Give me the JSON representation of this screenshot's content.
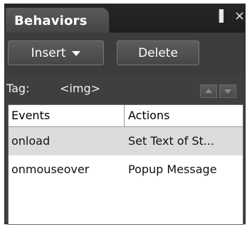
{
  "panel": {
    "title": "Behaviors",
    "pin_glyph": "▌",
    "close_glyph": "×"
  },
  "toolbar": {
    "insert_label": "Insert",
    "delete_label": "Delete"
  },
  "tag": {
    "label": "Tag:",
    "value": "<img>"
  },
  "table": {
    "columns": [
      "Events",
      "Actions"
    ],
    "rows": [
      {
        "event": "onload",
        "action": "Set Text of St...",
        "selected": true
      },
      {
        "event": "onmouseover",
        "action": "Popup Message",
        "selected": false
      }
    ]
  },
  "icons": {
    "pin": "pin-icon",
    "close": "close-icon",
    "dropdown": "chevron-down-icon",
    "move_up": "arrow-up-icon",
    "move_down": "arrow-down-icon"
  },
  "colors": {
    "panel_bg": "#3f3f3f",
    "tab_bg": "#4f4f4f",
    "selected_row": "#dcdcdc"
  }
}
